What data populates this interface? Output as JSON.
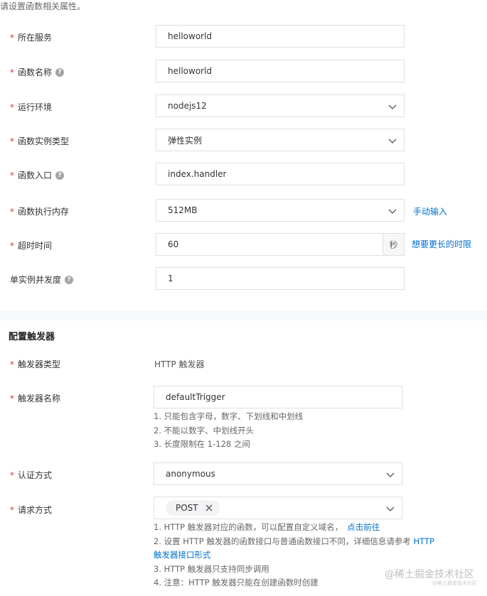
{
  "header_hint": "请设置函数相关属性。",
  "form": {
    "service": {
      "label": "所在服务",
      "value": "helloworld"
    },
    "function_name": {
      "label": "函数名称",
      "value": "helloworld"
    },
    "runtime": {
      "label": "运行环境",
      "value": "nodejs12"
    },
    "instance_type": {
      "label": "函数实例类型",
      "value": "弹性实例"
    },
    "handler": {
      "label": "函数入口",
      "value": "index.handler"
    },
    "memory": {
      "label": "函数执行内存",
      "value": "512MB",
      "link": "手动输入"
    },
    "timeout": {
      "label": "超时时间",
      "value": "60",
      "unit": "秒",
      "link": "想要更长的时限"
    },
    "concurrency": {
      "label": "单实例并发度",
      "value": "1"
    }
  },
  "trigger": {
    "section_title": "配置触发器",
    "type": {
      "label": "触发器类型",
      "value": "HTTP 触发器"
    },
    "name": {
      "label": "触发器名称",
      "value": "defaultTrigger",
      "notes": [
        "1. 只能包含字母，数字、下划线和中划线",
        "2. 不能以数字、中划线开头",
        "3. 长度限制在 1-128 之间"
      ]
    },
    "auth": {
      "label": "认证方式",
      "value": "anonymous"
    },
    "methods": {
      "label": "请求方式",
      "selected": [
        "POST"
      ],
      "notes": {
        "line1_text": "1. HTTP 触发器对应的函数，可以配置自定义域名，",
        "line1_link": "点击前往",
        "line2_text": "2. 设置 HTTP 触发器的函数接口与普通函数接口不同，详细信息请参考 ",
        "line2_link": "HTTP",
        "line3_link": "触发器接口形式",
        "line4": "3. HTTP 触发器只支持同步调用",
        "line5": "4. 注意：HTTP 触发器只能在创建函数时创建"
      }
    }
  },
  "watermark": {
    "main": "@稀土掘金技术社区",
    "sub": "@稀土掘金技术社区"
  }
}
